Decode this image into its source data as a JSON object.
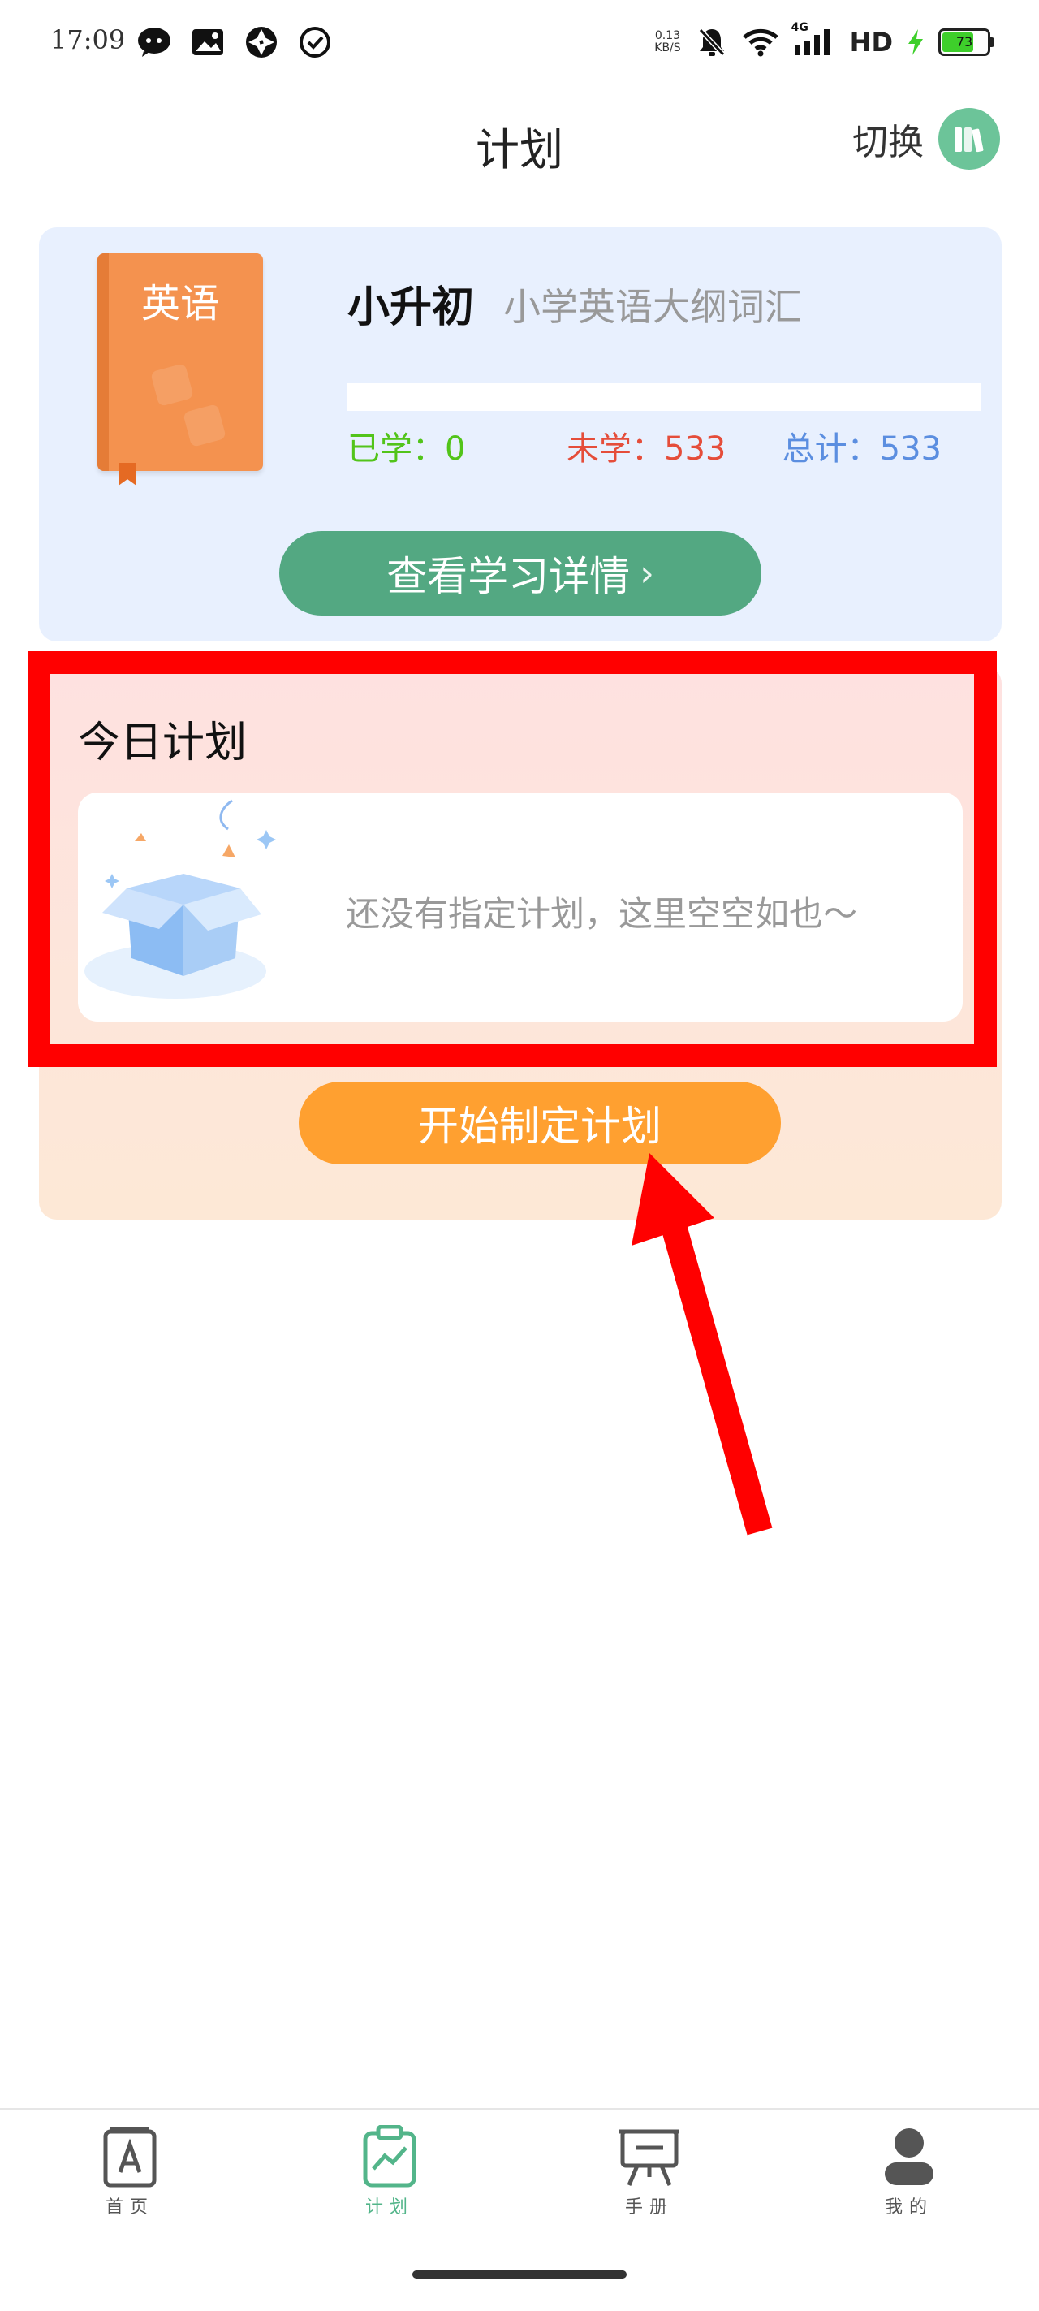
{
  "status_bar": {
    "time": "17:09",
    "net_speed_value": "0.13",
    "net_speed_unit": "KB/S",
    "network": "4G",
    "hd": "HD",
    "battery": "73",
    "battery_level": 0.73,
    "left_icons": [
      "wechat-icon",
      "gallery-icon",
      "aperture-icon",
      "check-circle-icon"
    ],
    "right_icons": [
      "mute-bell-icon",
      "wifi-icon",
      "signal-icon",
      "charging-icon"
    ]
  },
  "header": {
    "title": "计划",
    "switch_label": "切换",
    "switch_icon": "books-icon"
  },
  "book": {
    "cover_label": "英语",
    "title": "小升初",
    "subtitle": "小学英语大纲词汇",
    "progress": 0,
    "learned": "已学：0",
    "unlearned": "未学：533",
    "total": "总计：533",
    "detail_button": "查看学习详情",
    "detail_chevron": "›"
  },
  "today_plan": {
    "title": "今日计划",
    "empty_text": "还没有指定计划，这里空空如也～",
    "start_button": "开始制定计划"
  },
  "nav": {
    "items": [
      {
        "label": "首页",
        "icon": "book-a-icon"
      },
      {
        "label": "计划",
        "icon": "clipboard-chart-icon"
      },
      {
        "label": "手册",
        "icon": "easel-icon"
      },
      {
        "label": "我的",
        "icon": "person-icon"
      }
    ],
    "active_index": 1
  },
  "colors": {
    "accent_green": "#53a882",
    "orange": "#ffa030",
    "annotation_red": "#ff0000"
  }
}
